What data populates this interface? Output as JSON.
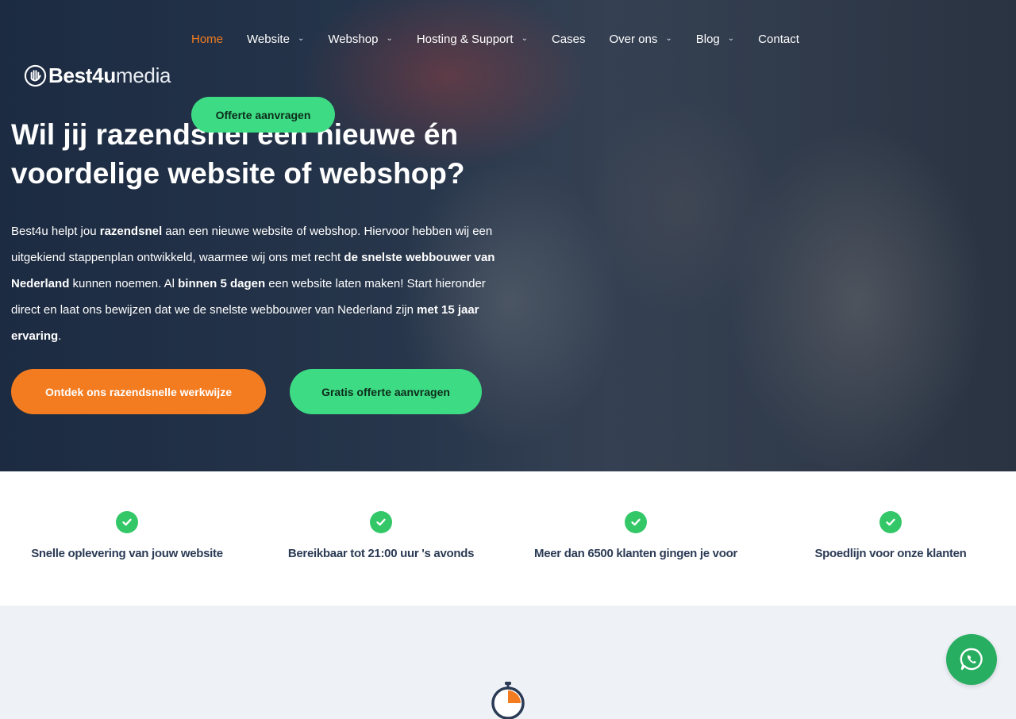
{
  "nav": {
    "items": [
      {
        "label": "Home",
        "active": true,
        "dropdown": false
      },
      {
        "label": "Website",
        "active": false,
        "dropdown": true
      },
      {
        "label": "Webshop",
        "active": false,
        "dropdown": true
      },
      {
        "label": "Hosting & Support",
        "active": false,
        "dropdown": true
      },
      {
        "label": "Cases",
        "active": false,
        "dropdown": false
      },
      {
        "label": "Over ons",
        "active": false,
        "dropdown": true
      },
      {
        "label": "Blog",
        "active": false,
        "dropdown": true
      },
      {
        "label": "Contact",
        "active": false,
        "dropdown": false
      }
    ],
    "cta_label": "Offerte aanvragen"
  },
  "logo": {
    "bold": "Best4u",
    "light": "media",
    "icon": "hand-logo-icon"
  },
  "hero": {
    "headline": "Wil jij razendsnel een nieuwe én voordelige website of webshop?",
    "intro": [
      {
        "text": "Best4u helpt jou ",
        "bold": false
      },
      {
        "text": "razendsnel",
        "bold": true
      },
      {
        "text": " aan een nieuwe website of webshop. Hiervoor hebben wij een uitgekiend stappenplan ontwikkeld, waarmee wij ons met recht ",
        "bold": false
      },
      {
        "text": "de snelste webbouwer van Nederland",
        "bold": true
      },
      {
        "text": " kunnen noemen. Al ",
        "bold": false
      },
      {
        "text": "binnen 5 dagen",
        "bold": true
      },
      {
        "text": " een website laten maken! Start hieronder direct en laat ons bewijzen dat we de snelste webbouwer van Nederland zijn ",
        "bold": false
      },
      {
        "text": "met 15 jaar ervaring",
        "bold": true
      },
      {
        "text": ".",
        "bold": false
      }
    ],
    "primary_button": "Ontdek ons razendsnelle werkwijze",
    "secondary_button": "Gratis offerte aanvragen"
  },
  "usps": [
    {
      "label": "Snelle oplevering van jouw website",
      "icon": "check-circle-icon"
    },
    {
      "label": "Bereikbaar tot 21:00 uur 's avonds",
      "icon": "check-circle-icon"
    },
    {
      "label": "Meer dan 6500 klanten gingen je voor",
      "icon": "check-circle-icon"
    },
    {
      "label": "Spoedlijn voor onze klanten",
      "icon": "check-circle-icon"
    }
  ],
  "colors": {
    "accent_orange": "#f47c20",
    "accent_green": "#3ddc84",
    "check_green": "#34c768",
    "whatsapp_green": "#27ae60",
    "heading_navy": "#2b3b55"
  },
  "floating": {
    "whatsapp_icon": "whatsapp-icon"
  },
  "section_icon": "stopwatch-icon"
}
